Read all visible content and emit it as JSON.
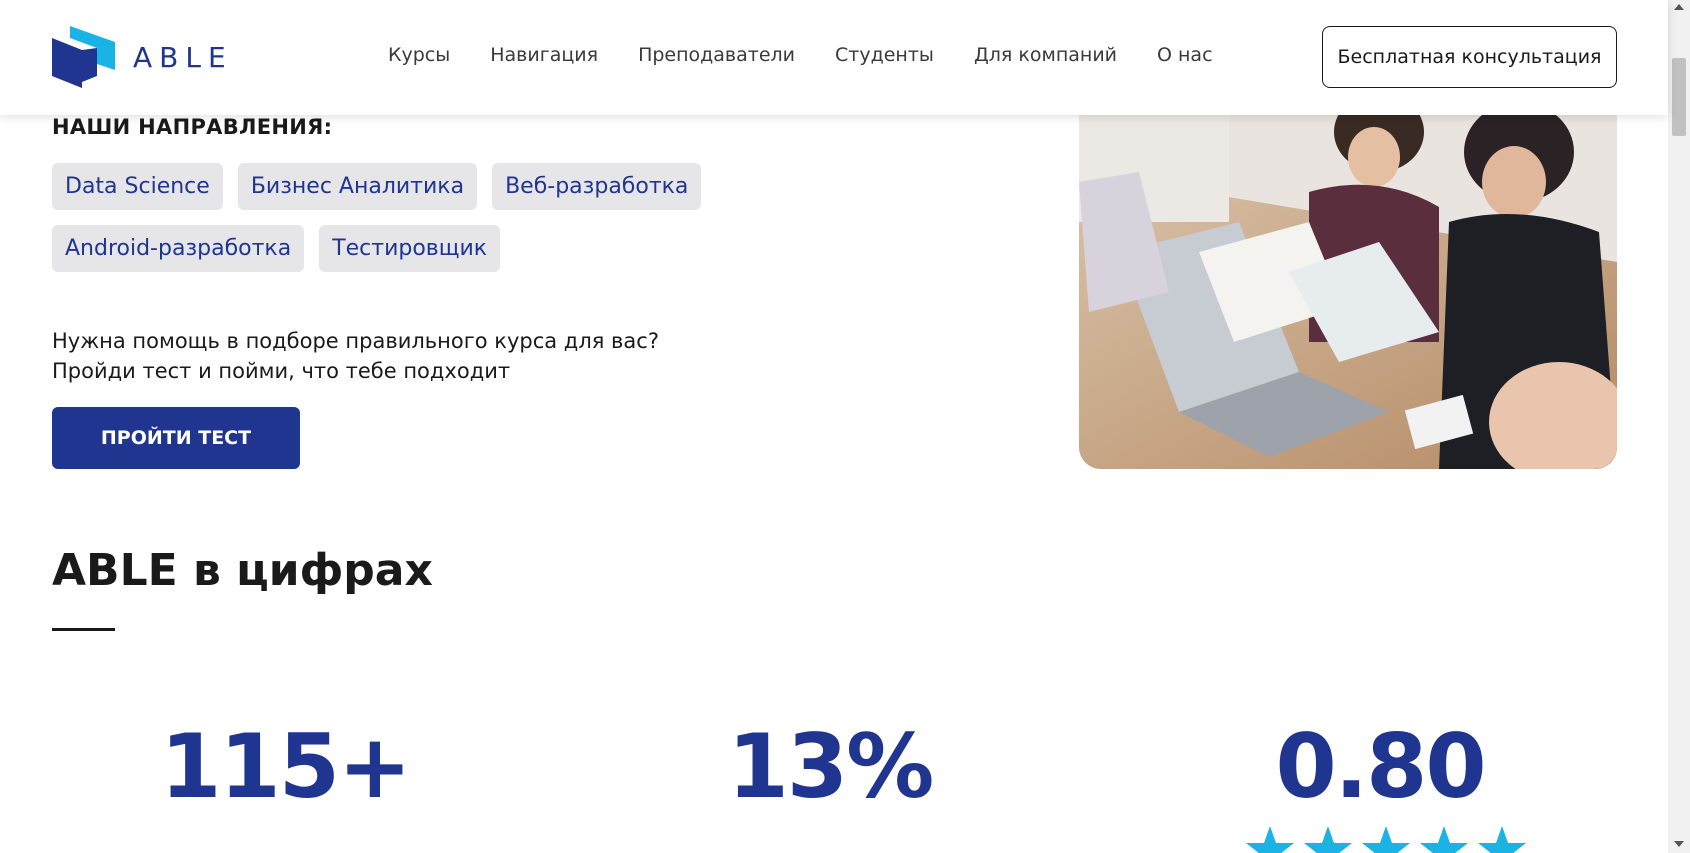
{
  "header": {
    "logo_text": "ABLE",
    "nav": [
      "Курсы",
      "Навигация",
      "Преподаватели",
      "Студенты",
      "Для компаний",
      "О нас"
    ],
    "consult_label": "Бесплатная консультация"
  },
  "directions": {
    "title": "НАШИ НАПРАВЛЕНИЯ:",
    "chips": [
      "Data Science",
      "Бизнес Аналитика",
      "Веб-разработка",
      "Android-разработка",
      "Тестировщик"
    ]
  },
  "help": {
    "line1": "Нужна помощь в подборе правильного курса для вас?",
    "line2": "Пройди тест и пойми, что тебе подходит",
    "button": "ПРОЙТИ ТЕСТ"
  },
  "stats": {
    "title": "ABLE в цифрах",
    "items": [
      "115+",
      "13%",
      "0.80"
    ],
    "rating_stars": 5
  },
  "colors": {
    "brand": "#1f3590",
    "accent": "#1bb3e6",
    "chip_bg": "#e6e6e8"
  }
}
